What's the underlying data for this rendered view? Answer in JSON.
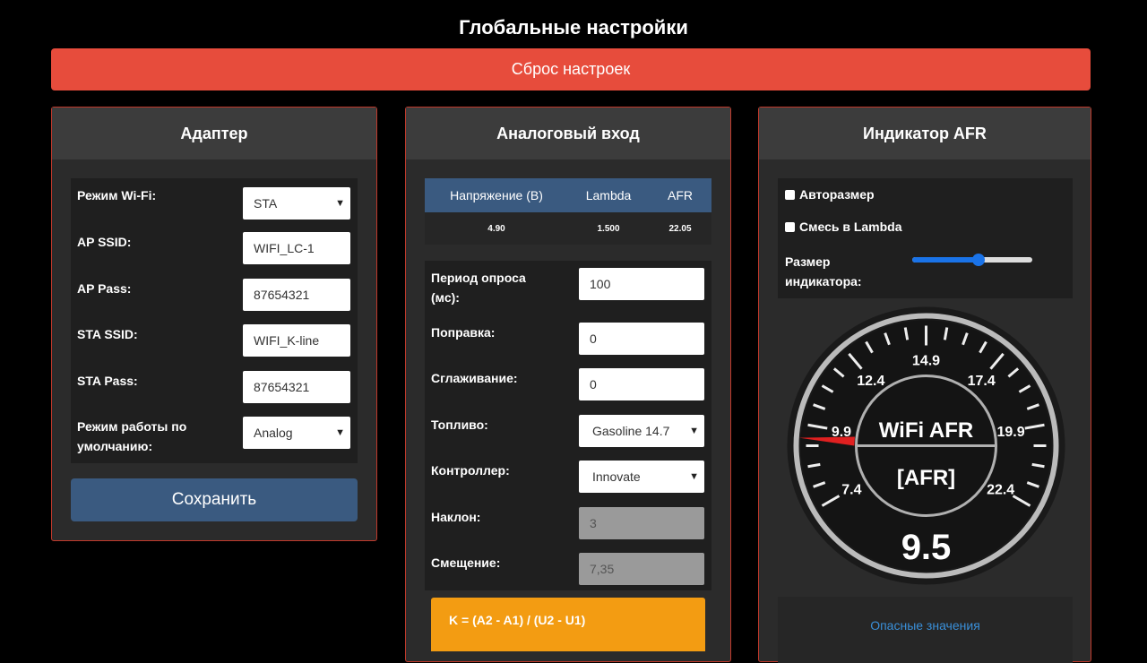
{
  "page": {
    "title": "Глобальные настройки",
    "reset_label": "Сброс настроек"
  },
  "adapter": {
    "title": "Адаптер",
    "wifi_mode_label": "Режим Wi-Fi:",
    "wifi_mode_value": "STA",
    "ap_ssid_label": "AP SSID:",
    "ap_ssid_value": "WIFI_LC-1",
    "ap_pass_label": "AP Pass:",
    "ap_pass_value": "87654321",
    "sta_ssid_label": "STA SSID:",
    "sta_ssid_value": "WIFI_K-line",
    "sta_pass_label": "STA Pass:",
    "sta_pass_value": "87654321",
    "default_mode_label_1": "Режим работы по",
    "default_mode_label_2": "умолчанию:",
    "default_mode_value": "Analog",
    "save_label": "Сохранить"
  },
  "analog": {
    "title": "Аналоговый вход",
    "table": {
      "headers": [
        "Напряжение (В)",
        "Lambda",
        "AFR"
      ],
      "values": [
        "4.90",
        "1.500",
        "22.05"
      ]
    },
    "poll_label_1": "Период опроса",
    "poll_label_2": "(мс):",
    "poll_value": "100",
    "correction_label": "Поправка:",
    "correction_value": "0",
    "smoothing_label": "Сглаживание:",
    "smoothing_value": "0",
    "fuel_label": "Топливо:",
    "fuel_value": "Gasoline 14.7",
    "controller_label": "Контроллер:",
    "controller_value": "Innovate",
    "slope_label": "Наклон:",
    "slope_value": "3",
    "offset_label": "Смещение:",
    "offset_value": "7,35",
    "formula": "K = (A2 - A1) / (U2 - U1)"
  },
  "afr": {
    "title": "Индикатор AFR",
    "autosize_label": "Авторазмер",
    "lambda_label": "Смесь в Lambda",
    "size_label_1": "Размер",
    "size_label_2": "индикатора:",
    "size_slider_fraction": 0.55,
    "gauge": {
      "title": "WiFi AFR",
      "unit": "[AFR]",
      "value": "9.5",
      "numeric_value": 9.5,
      "min": 7.4,
      "max": 22.4,
      "ticks": [
        "7.4",
        "9.9",
        "12.4",
        "14.9",
        "17.4",
        "19.9",
        "22.4"
      ],
      "needle_color": "#e02020"
    },
    "danger_label": "Опасные значения"
  },
  "colors": {
    "reset": "#e74c3c",
    "save": "#3a5a80",
    "formula": "#f39c12",
    "link": "#3a8fd8"
  }
}
